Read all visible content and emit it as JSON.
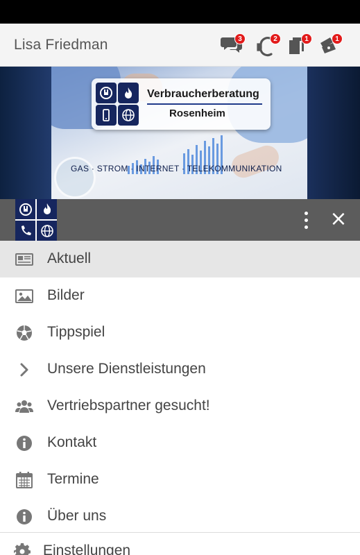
{
  "header": {
    "username": "Lisa Friedman",
    "icons": [
      {
        "name": "chat-icon",
        "badge": "3"
      },
      {
        "name": "euro-icon",
        "badge": "2"
      },
      {
        "name": "documents-icon",
        "badge": "1"
      },
      {
        "name": "coupons-icon",
        "badge": "1"
      }
    ],
    "badge_color": "#e21b1b"
  },
  "banner": {
    "brand_line1": "Verbraucherberatung",
    "brand_line2": "Rosenheim",
    "tagline": "GAS · STROM · INTERNET · TELEKOMMUNIKATION"
  },
  "drawer": {
    "header_color": "#5c5c5c",
    "logo_color": "#16265e"
  },
  "menu": {
    "items": [
      {
        "label": "Aktuell",
        "icon": "newspaper-icon",
        "active": true
      },
      {
        "label": "Bilder",
        "icon": "image-icon",
        "active": false
      },
      {
        "label": "Tippspiel",
        "icon": "soccer-ball-icon",
        "active": false
      },
      {
        "label": "Unsere Dienstleistungen",
        "icon": "chevron-right-icon",
        "active": false
      },
      {
        "label": "Vertriebspartner gesucht!",
        "icon": "users-icon",
        "active": false
      },
      {
        "label": "Kontakt",
        "icon": "info-icon",
        "active": false
      },
      {
        "label": "Termine",
        "icon": "calendar-icon",
        "active": false
      },
      {
        "label": "Über uns",
        "icon": "info-icon",
        "active": false
      }
    ],
    "settings_label": "Einstellungen"
  }
}
